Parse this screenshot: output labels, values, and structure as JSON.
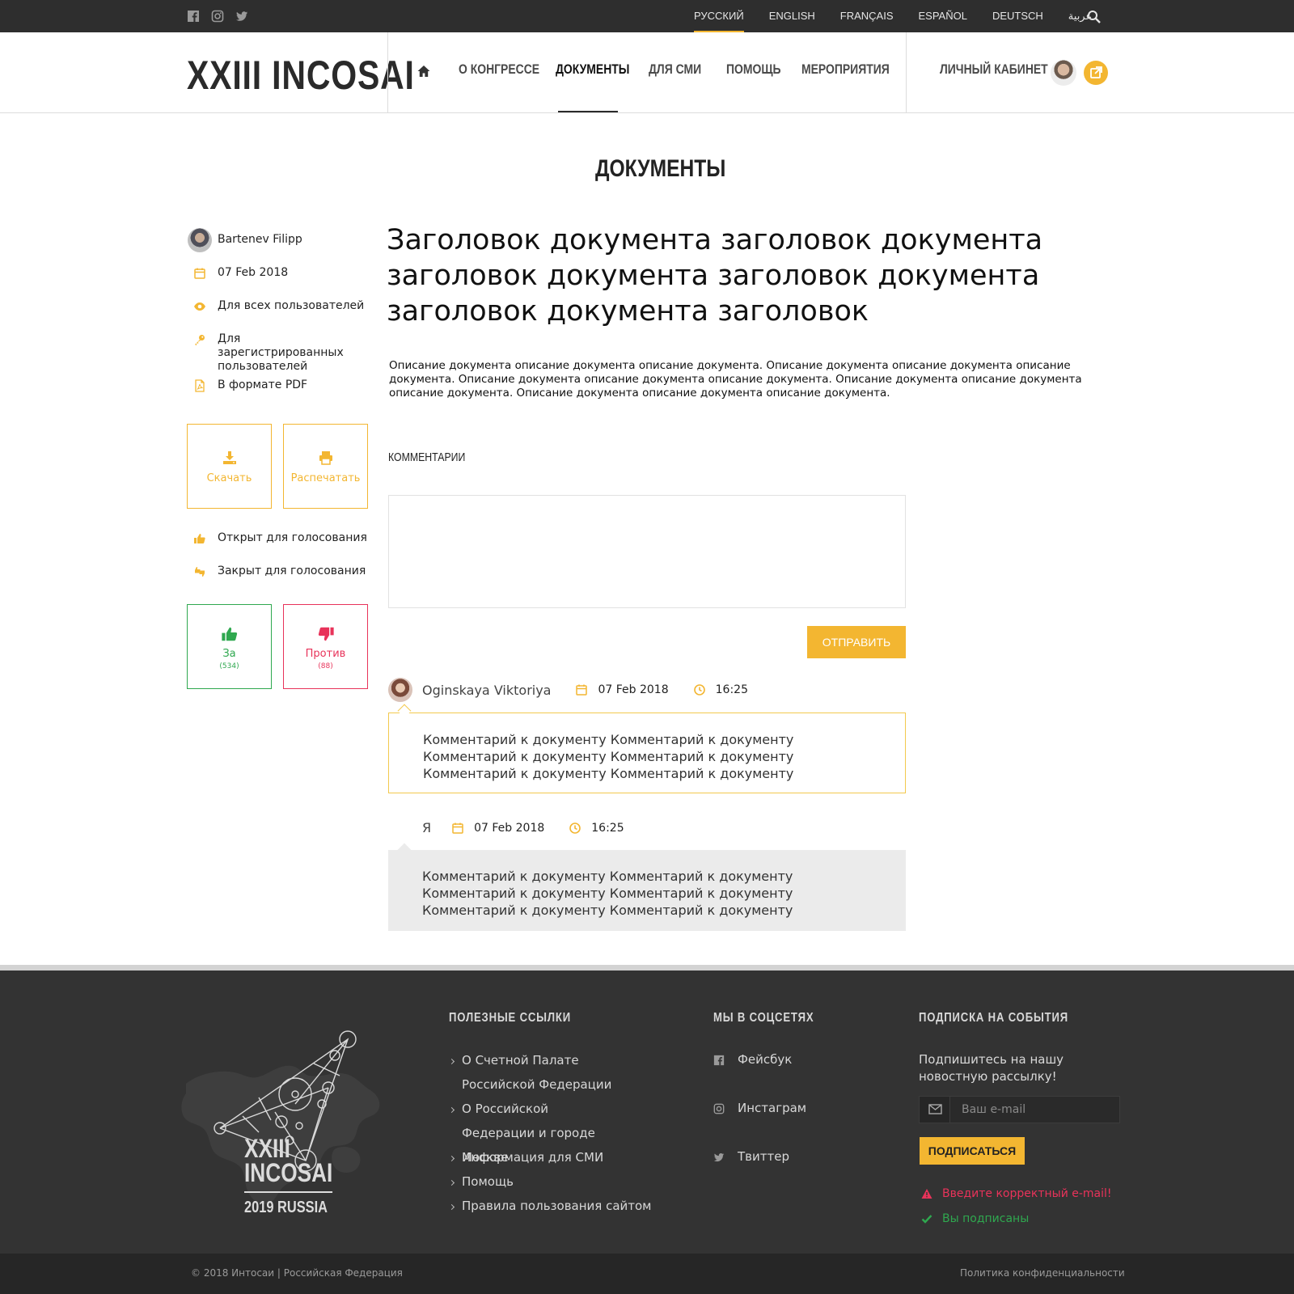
{
  "topbar": {
    "languages": [
      "РУССКИЙ",
      "ENGLISH",
      "FRANÇAIS",
      "ESPAÑOL",
      "DEUTSCH",
      "عربية"
    ],
    "active_language": "РУССКИЙ",
    "icons": [
      "facebook-icon",
      "instagram-icon",
      "twitter-icon",
      "search-icon"
    ]
  },
  "header": {
    "logo": "XXIII INCOSAI",
    "nav": [
      "О КОНГРЕССЕ",
      "ДОКУМЕНТЫ",
      "ДЛЯ СМИ",
      "ПОМОЩЬ",
      "МЕРОПРИЯТИЯ"
    ],
    "active_nav": "ДОКУМЕНТЫ",
    "cabinet": "ЛИЧНЫЙ КАБИНЕТ"
  },
  "page": {
    "title": "ДОКУМЕНТЫ"
  },
  "sidebar": {
    "author": "Bartenev Filipp",
    "date": "07 Feb 2018",
    "access_all": "Для всех пользователей",
    "access_registered": "Для зарегистрированных пользователей",
    "format": "В формате PDF",
    "download": "Скачать",
    "print": "Распечатать",
    "voting_open": "Открыт для голосования",
    "voting_closed": "Закрыт для голосования",
    "vote_for": {
      "label": "За",
      "count": "(534)"
    },
    "vote_against": {
      "label": "Против",
      "count": "(88)"
    },
    "accent_color": "#f3b631",
    "for_color": "#2fa84f",
    "against_color": "#e8335a"
  },
  "document": {
    "title": "Заголовок документа заголовок документа заголовок документа заголовок документа заголовок документа заголовок",
    "description": "Описание документа описание документа описание документа. Описание документа описание документа описание документа. Описание документа описание документа описание документа. Описание документа описание документа описание документа. Описание документа описание документа описание документа."
  },
  "comments": {
    "heading": "КОММЕНТАРИИ",
    "send": "ОТПРАВИТЬ",
    "items": [
      {
        "author": "Oginskaya Viktoriya",
        "date": "07 Feb 2018",
        "time": "16:25",
        "text": "Комментарий к документу Комментарий к документу Комментарий к документу Комментарий к документу Комментарий к документу Комментарий к документу"
      },
      {
        "author": "Я",
        "date": "07 Feb 2018",
        "time": "16:25",
        "text": "Комментарий к документу Комментарий к документу Комментарий к документу Комментарий к документу Комментарий к документу Комментарий к документу"
      }
    ]
  },
  "footer": {
    "logo_line1": "XXIII",
    "logo_line2": "INCOSAI",
    "logo_line3": "2019 RUSSIA",
    "links_heading": "ПОЛЕЗНЫЕ ССЫЛКИ",
    "links": [
      "О Счетной Палате Российской Федерации",
      "О Российской Федерации и городе Москве",
      "Информация для СМИ",
      "Помощь",
      "Правила пользования сайтом"
    ],
    "social_heading": "МЫ В СОЦСЕТЯХ",
    "social": [
      "Фейсбук",
      "Инстаграм",
      "Твиттер"
    ],
    "subscribe_heading": "ПОДПИСКА НА СОБЫТИЯ",
    "subscribe_text": "Подпишитесь на нашу новостную рассылку!",
    "email_placeholder": "Ваш e-mail",
    "subscribe_button": "ПОДПИСАТЬСЯ",
    "error_msg": "Введите корректный e-mail!",
    "success_msg": "Вы подписаны",
    "error_color": "#e8335a",
    "success_color": "#2fa84f",
    "copyright": "© 2018 Интосаи | Российская Федерация",
    "policy": "Политика конфиденциальности"
  }
}
